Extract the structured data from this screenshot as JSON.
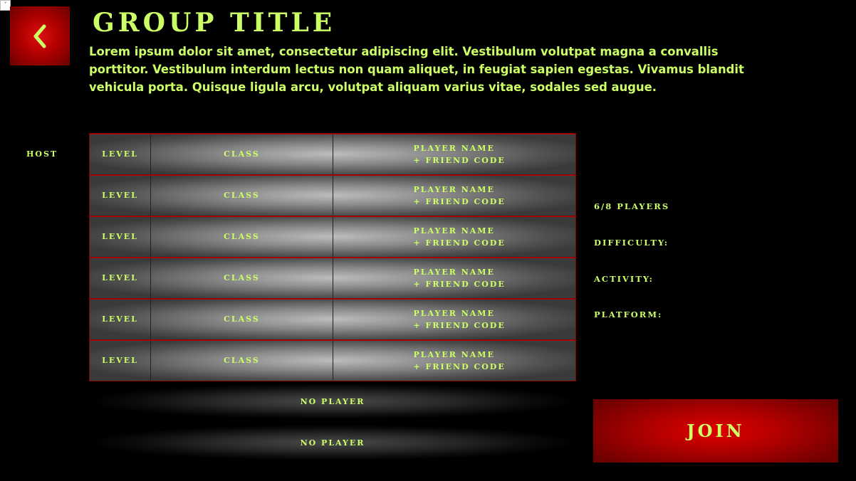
{
  "header": {
    "title": "GROUP TITLE",
    "description": "Lorem ipsum dolor sit amet, consectetur adipiscing elit. Vestibulum volutpat magna a convallis porttitor. Vestibulum interdum lectus non quam aliquet, in feugiat sapien egestas. Vivamus blandit vehicula porta. Quisque ligula arcu, volutpat aliquam varius vitae, sodales sed augue.",
    "back_icon": "chevron-left-icon",
    "corner_control": "˅"
  },
  "roster": {
    "host_label": "HOST",
    "rows": [
      {
        "level": "LEVEL",
        "class": "CLASS",
        "player_name": "PLAYER NAME",
        "friend_code": "+ FRIEND CODE"
      },
      {
        "level": "LEVEL",
        "class": "CLASS",
        "player_name": "PLAYER NAME",
        "friend_code": "+ FRIEND CODE"
      },
      {
        "level": "LEVEL",
        "class": "CLASS",
        "player_name": "PLAYER NAME",
        "friend_code": "+ FRIEND CODE"
      },
      {
        "level": "LEVEL",
        "class": "CLASS",
        "player_name": "PLAYER NAME",
        "friend_code": "+ FRIEND CODE"
      },
      {
        "level": "LEVEL",
        "class": "CLASS",
        "player_name": "PLAYER NAME",
        "friend_code": "+ FRIEND CODE"
      },
      {
        "level": "LEVEL",
        "class": "CLASS",
        "player_name": "PLAYER NAME",
        "friend_code": "+ FRIEND CODE"
      }
    ],
    "empty_slots": [
      "NO PLAYER",
      "NO PLAYER"
    ]
  },
  "info": {
    "players": "6/8 PLAYERS",
    "difficulty": "DIFFICULTY:",
    "activity": "ACTIVITY:",
    "platform": "PLATFORM:"
  },
  "actions": {
    "join_label": "JOIN"
  },
  "colors": {
    "text_accent": "#ccff66",
    "brand_red": "#b00000",
    "background": "#000000"
  }
}
